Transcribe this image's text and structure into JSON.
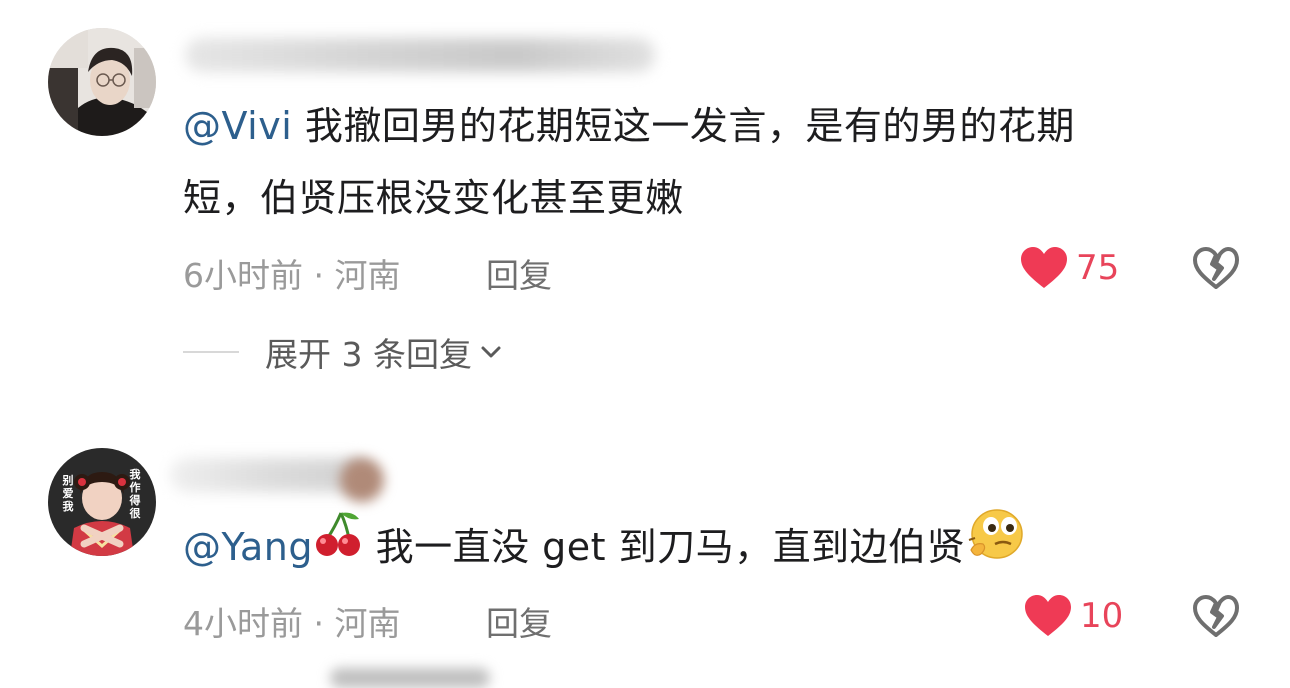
{
  "comments": [
    {
      "mention": "@Vivi",
      "text_line1": " 我撤回男的花期短这一发言，是有的男的花期",
      "text_line2": "短，伯贤压根没变化甚至更嫩",
      "time": "6小时前",
      "separator": " · ",
      "location": "河南",
      "reply_label": "回复",
      "likes": "75",
      "expand_label": "展开 3 条回复"
    },
    {
      "mention": "@Yang",
      "mention_emoji": "cherry-emoji",
      "text": " 我一直没 get 到刀马，直到边伯贤",
      "trailing_emoji": "thinking-face-emoji",
      "time": "4小时前",
      "separator": " · ",
      "location": "河南",
      "reply_label": "回复",
      "likes": "10",
      "avatar_text_left": "别\n爱\n我",
      "avatar_text_right": "我\n作\n得\n很"
    }
  ],
  "colors": {
    "mention": "#2d5f8d",
    "like_red": "#e8445a",
    "meta_gray": "#9a9a9a"
  }
}
